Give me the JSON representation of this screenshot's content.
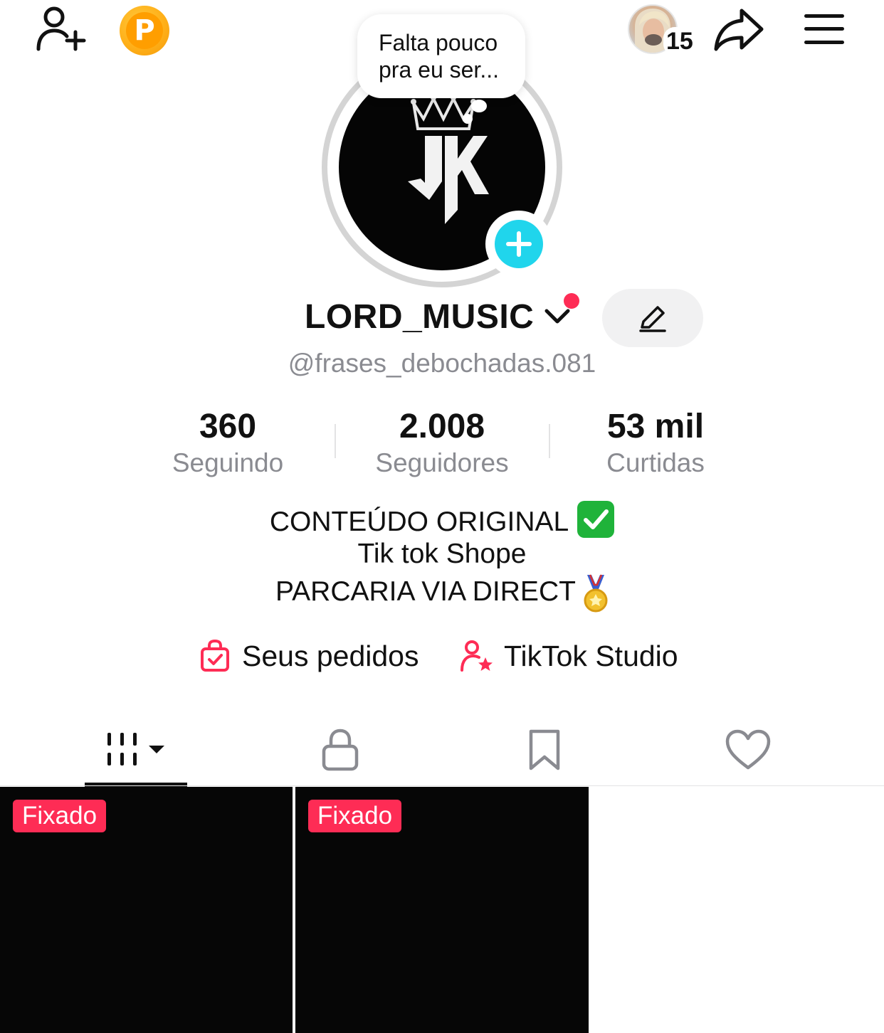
{
  "header": {
    "add_friend_icon": "person-add-icon",
    "coin_letter": "P",
    "friends_count": "15",
    "share_icon": "share-arrow-icon",
    "menu_icon": "hamburger-menu-icon"
  },
  "note_bubble": {
    "line1": "Falta pouco",
    "line2": "pra eu ser..."
  },
  "profile": {
    "display_name": "LORD_MUSIC",
    "username": "@frases_debochadas.081",
    "avatar_initials": "JK"
  },
  "stats": [
    {
      "value": "360",
      "label": "Seguindo"
    },
    {
      "value": "2.008",
      "label": "Seguidores"
    },
    {
      "value": "53 mil",
      "label": "Curtidas"
    }
  ],
  "bio": {
    "line1": "CONTEÚDO ORIGINAL",
    "line2": "Tik tok Shope",
    "line3": "PARCARIA VIA DIRECT"
  },
  "links": {
    "orders": "Seus pedidos",
    "studio": "TikTok Studio"
  },
  "tabs": [
    "videos-grid",
    "private",
    "saved",
    "liked"
  ],
  "videos": [
    {
      "badge": "Fixado"
    },
    {
      "badge": "Fixado"
    }
  ],
  "colors": {
    "accent": "#fe2c55",
    "add_button": "#20d5ec",
    "muted_text": "#8a8b91",
    "coin": "#ffb019"
  }
}
